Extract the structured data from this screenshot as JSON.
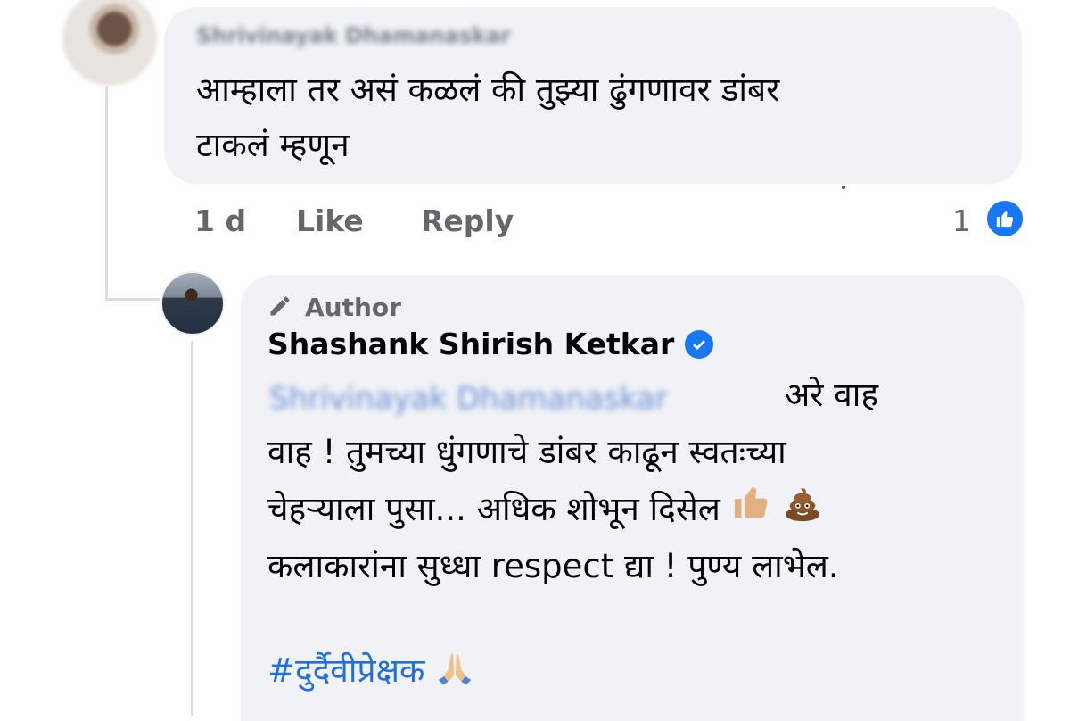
{
  "comment": {
    "author_name": "Shrivinayak Dhamanaskar",
    "text_lines": [
      "आम्हाला तर असं कळलं की तुझ्या ढुंगणावर डांबर",
      "टाकलं म्हणून"
    ],
    "time": "1 d",
    "like_label": "Like",
    "reply_label": "Reply",
    "reaction_count": "1"
  },
  "reply": {
    "badge_label": "Author",
    "author_name": "Shashank Shirish Ketkar",
    "mention": "Shrivinayak Dhamanaskar",
    "text_lines": [
      "अरे वाह",
      "वाह ! तुमच्या धुंगणाचे डांबर काढून स्वतःच्या",
      "चेहऱ्याला पुसा... अधिक शोभून दिसेल",
      "कलाकारांना सुध्धा respect द्या ! पुण्य लाभेल."
    ],
    "hashtag": "#दुर्दैवीप्रेक्षक"
  },
  "colors": {
    "bubble": "#f0f2f5",
    "link": "#216fdb",
    "meta": "#65676b",
    "facebook_blue": "#1877f2"
  }
}
